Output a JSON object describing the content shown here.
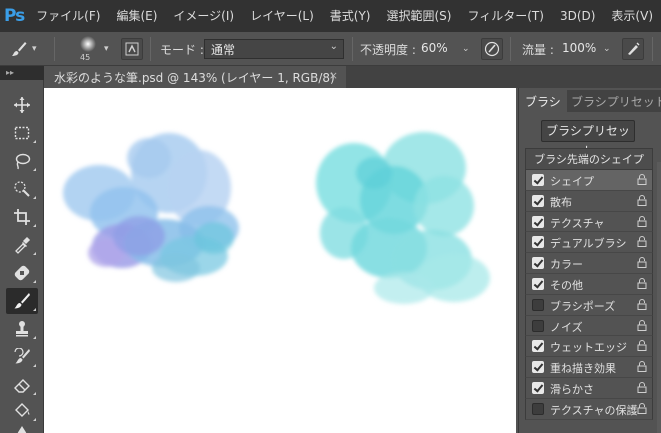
{
  "app": {
    "logo": "Ps"
  },
  "menu": [
    "ファイル(F)",
    "編集(E)",
    "イメージ(I)",
    "レイヤー(L)",
    "書式(Y)",
    "選択範囲(S)",
    "フィルター(T)",
    "3D(D)",
    "表示(V)"
  ],
  "options": {
    "brush_size": "45",
    "mode_label": "モード :",
    "mode_value": "通常",
    "opacity_label": "不透明度 :",
    "opacity_value": "60%",
    "flow_label": "流量 :",
    "flow_value": "100%"
  },
  "toolbar": {
    "collapse_glyph": "▸▸"
  },
  "document_tab": {
    "title": "水彩のような筆.psd @ 143% (レイヤー 1, RGB/8)",
    "close": "×"
  },
  "panel": {
    "tabs": [
      "ブラシ",
      "ブラシプリセット"
    ],
    "preset_button": "ブラシプリセット",
    "header": "ブラシ先端のシェイプ",
    "items": [
      {
        "label": "シェイプ",
        "checked": true,
        "selected": true
      },
      {
        "label": "散布",
        "checked": true,
        "selected": false
      },
      {
        "label": "テクスチャ",
        "checked": true,
        "selected": false
      },
      {
        "label": "デュアルブラシ",
        "checked": true,
        "selected": false
      },
      {
        "label": "カラー",
        "checked": true,
        "selected": false
      },
      {
        "label": "その他",
        "checked": true,
        "selected": false
      },
      {
        "label": "ブラシポーズ",
        "checked": false,
        "selected": false
      },
      {
        "label": "ノイズ",
        "checked": false,
        "selected": false
      },
      {
        "label": "ウェットエッジ",
        "checked": true,
        "selected": false
      },
      {
        "label": "重ね描き効果",
        "checked": true,
        "selected": false
      },
      {
        "label": "滑らかさ",
        "checked": true,
        "selected": false
      },
      {
        "label": "テクスチャの保護",
        "checked": false,
        "selected": false
      }
    ]
  },
  "colors": {
    "ps_blue": "#3a9ee8",
    "watercolor_blue": "#9cc8ee",
    "watercolor_violet": "#9b9ee8",
    "watercolor_cyan": "#54d6dc"
  }
}
